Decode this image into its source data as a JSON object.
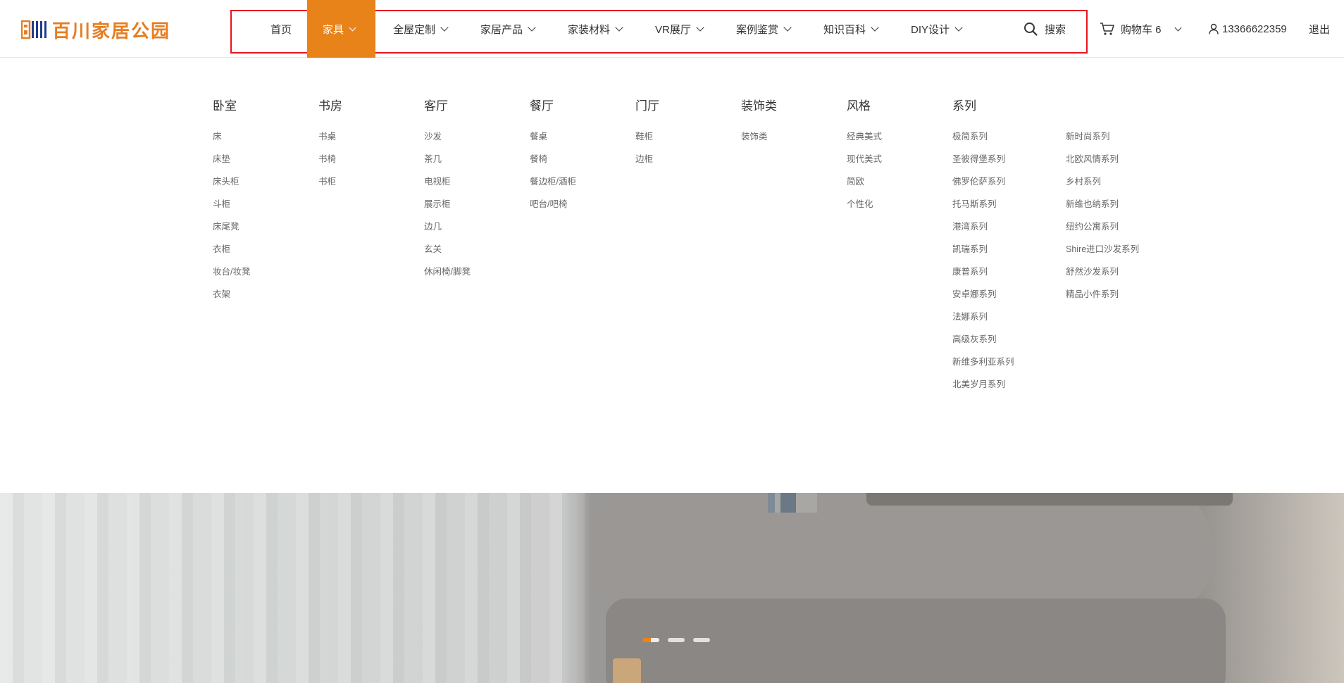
{
  "brand": {
    "name": "百川家居公园",
    "accent": "#e8831a",
    "outline": "#e8141e"
  },
  "nav": {
    "items": [
      {
        "label": "首页",
        "dropdown": false,
        "active": false
      },
      {
        "label": "家具",
        "dropdown": true,
        "active": true
      },
      {
        "label": "全屋定制",
        "dropdown": true,
        "active": false
      },
      {
        "label": "家居产品",
        "dropdown": true,
        "active": false
      },
      {
        "label": "家装材料",
        "dropdown": true,
        "active": false
      },
      {
        "label": "VR展厅",
        "dropdown": true,
        "active": false
      },
      {
        "label": "案例鉴赏",
        "dropdown": true,
        "active": false
      },
      {
        "label": "知识百科",
        "dropdown": true,
        "active": false
      },
      {
        "label": "DIY设计",
        "dropdown": true,
        "active": false
      }
    ],
    "search_label": "搜索",
    "cart_label": "购物车 6",
    "user_phone": "13366622359",
    "logout_label": "退出"
  },
  "mega_menu": {
    "columns": [
      {
        "title": "卧室",
        "items": [
          "床",
          "床垫",
          "床头柜",
          "斗柜",
          "床尾凳",
          "衣柜",
          "妆台/妆凳",
          "衣架"
        ]
      },
      {
        "title": "书房",
        "items": [
          "书桌",
          "书椅",
          "书柜"
        ]
      },
      {
        "title": "客厅",
        "items": [
          "沙发",
          "茶几",
          "电视柜",
          "展示柜",
          "边几",
          "玄关",
          "休闲椅/脚凳"
        ]
      },
      {
        "title": "餐厅",
        "items": [
          "餐桌",
          "餐椅",
          "餐边柜/酒柜",
          "吧台/吧椅"
        ]
      },
      {
        "title": "门厅",
        "items": [
          "鞋柜",
          "边柜"
        ]
      },
      {
        "title": "装饰类",
        "items": [
          "装饰类"
        ]
      },
      {
        "title": "风格",
        "items": [
          "经典美式",
          "现代美式",
          "简欧",
          "个性化"
        ]
      },
      {
        "title": "系列",
        "items": [
          "极简系列",
          "圣彼得堡系列",
          "佛罗伦萨系列",
          "托马斯系列",
          "港湾系列",
          "凯瑞系列",
          "康普系列",
          "安卓娜系列",
          "法娜系列",
          "高级灰系列",
          "新维多利亚系列",
          "北美岁月系列"
        ]
      },
      {
        "title": "",
        "items": [
          "新时尚系列",
          "北欧风情系列",
          "乡村系列",
          "新维也纳系列",
          "纽约公寓系列",
          "Shire进口沙发系列",
          "舒然沙发系列",
          "精品小件系列"
        ]
      }
    ]
  },
  "banner": {
    "slides_total": 3,
    "active_slide": 1
  }
}
